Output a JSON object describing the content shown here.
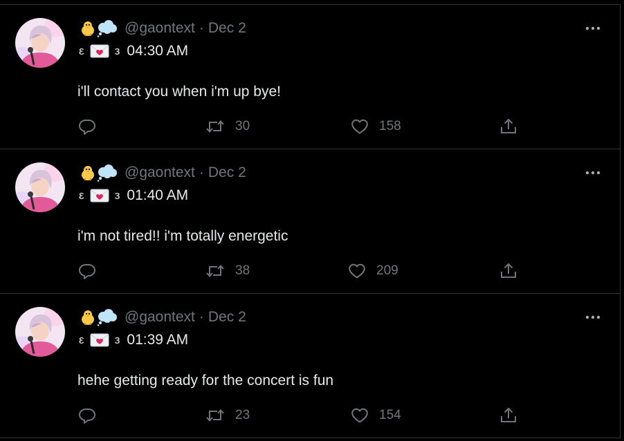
{
  "colors": {
    "background": "#000000",
    "divider": "#2f3336",
    "primary_text": "#e7e9ea",
    "secondary_text": "#71767b"
  },
  "tweets": [
    {
      "display_emojis": [
        "baby-chick",
        "thought-balloon"
      ],
      "handle": "@gaontext",
      "separator": "·",
      "date": "Dec 2",
      "bracket_left": "ε",
      "bracket_right": "з",
      "time": "04:30 AM",
      "text": "i'll contact you when i'm up bye!",
      "retweets": "30",
      "likes": "158"
    },
    {
      "display_emojis": [
        "baby-chick",
        "thought-balloon"
      ],
      "handle": "@gaontext",
      "separator": "·",
      "date": "Dec 2",
      "bracket_left": "ε",
      "bracket_right": "з",
      "time": "01:40 AM",
      "text": "i'm not tired!! i'm totally energetic",
      "retweets": "38",
      "likes": "209"
    },
    {
      "display_emojis": [
        "baby-chick",
        "thought-balloon"
      ],
      "handle": "@gaontext",
      "separator": "·",
      "date": "Dec 2",
      "bracket_left": "ε",
      "bracket_right": "з",
      "time": "01:39 AM",
      "text": "hehe getting ready for the concert is fun",
      "retweets": "23",
      "likes": "154"
    }
  ]
}
